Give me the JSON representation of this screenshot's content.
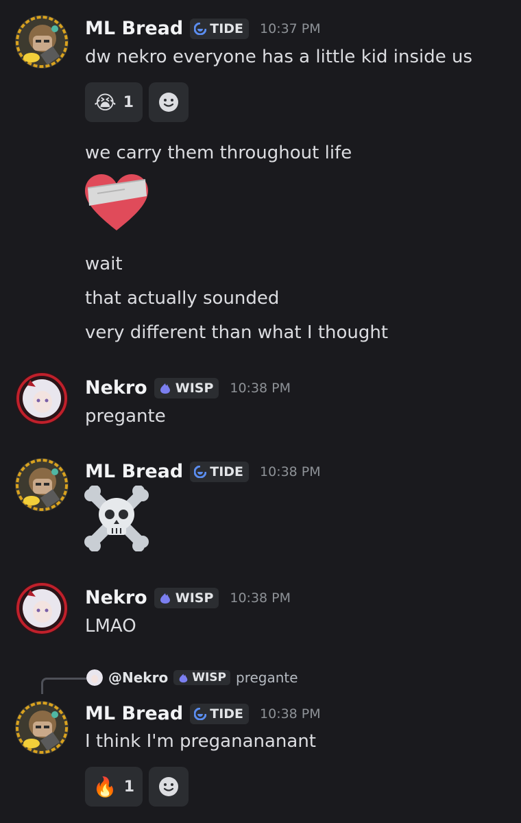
{
  "messages": {
    "m1": {
      "author": "ML Bread",
      "tag": "TIDE",
      "time": "10:37 PM",
      "text": "dw nekro everyone has a little kid inside us",
      "reaction_emoji": "😭",
      "reaction_count": "1"
    },
    "m2": {
      "text": "we carry them throughout life"
    },
    "m3": {
      "lines": [
        "wait",
        "that actually sounded",
        "very different than what I thought"
      ]
    },
    "m4": {
      "author": "Nekro",
      "tag": "WISP",
      "time": "10:38 PM",
      "text": "pregante"
    },
    "m5": {
      "author": "ML Bread",
      "tag": "TIDE",
      "time": "10:38 PM"
    },
    "m6": {
      "author": "Nekro",
      "tag": "WISP",
      "time": "10:38 PM",
      "text": "LMAO"
    },
    "m7": {
      "reply": {
        "mention": "@Nekro",
        "tag": "WISP",
        "text": "pregante"
      },
      "author": "ML Bread",
      "tag": "TIDE",
      "time": "10:38 PM",
      "text": "I think I'm preganananant",
      "reaction_emoji": "🔥",
      "reaction_count": "1"
    }
  },
  "colors": {
    "background": "#1a1a1e",
    "tide_icon": "#5b8def",
    "wisp_icon": "#7b7ff0",
    "heart": "#e04b5a"
  }
}
